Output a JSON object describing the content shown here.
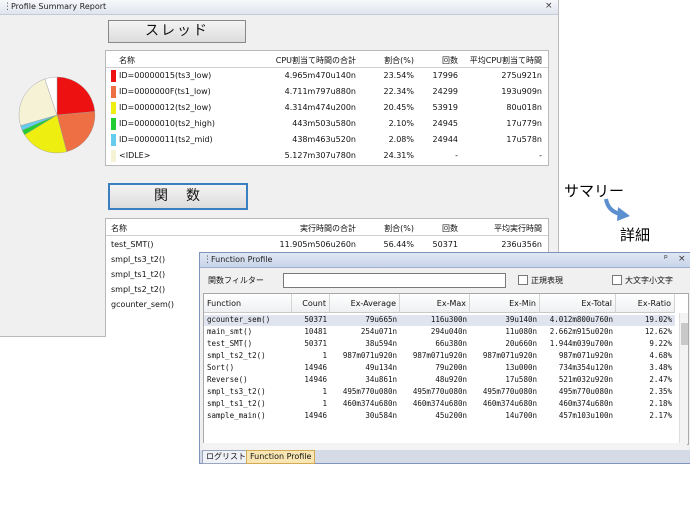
{
  "summary_window": {
    "title": "Profile Summary Report",
    "close": "×",
    "thread_button": "スレッド",
    "function_button": "関　数",
    "thread_table": {
      "headers": [
        "名称",
        "CPU割当て時間の合計",
        "割合(%)",
        "回数",
        "平均CPU割当て時間"
      ],
      "rows": [
        {
          "color": "#ee1111",
          "name": "ID=00000015(ts3_low)",
          "cpu": "4.965m470u140n",
          "pct": "23.54%",
          "count": "17996",
          "avg": "275u921n"
        },
        {
          "color": "#ee6f44",
          "name": "ID=0000000F(ts1_low)",
          "cpu": "4.711m797u880n",
          "pct": "22.34%",
          "count": "24299",
          "avg": "193u909n"
        },
        {
          "color": "#eeee11",
          "name": "ID=00000012(ts2_low)",
          "cpu": "4.314m474u200n",
          "pct": "20.45%",
          "count": "53919",
          "avg": "80u018n"
        },
        {
          "color": "#22cc33",
          "name": "ID=00000010(ts2_high)",
          "cpu": "443m503u580n",
          "pct": "2.10%",
          "count": "24945",
          "avg": "17u779n"
        },
        {
          "color": "#66ccee",
          "name": "ID=00000011(ts2_mid)",
          "cpu": "438m463u520n",
          "pct": "2.08%",
          "count": "24944",
          "avg": "17u578n"
        },
        {
          "color": "#f6f2d6",
          "name": "<IDLE>",
          "cpu": "5.127m307u780n",
          "pct": "24.31%",
          "count": "-",
          "avg": "-"
        }
      ]
    },
    "function_table": {
      "headers": [
        "名称",
        "実行時間の合計",
        "割合(%)",
        "回数",
        "平均実行時間"
      ],
      "rows": [
        {
          "name": "test_SMT()",
          "total": "11.905m506u260n",
          "pct": "56.44%",
          "count": "50371",
          "avg": "236u356n"
        },
        {
          "name": "smpl_ts3_t2()",
          "total": "",
          "pct": "",
          "count": "",
          "avg": ""
        },
        {
          "name": "smpl_ts1_t2()",
          "total": "",
          "pct": "",
          "count": "",
          "avg": ""
        },
        {
          "name": "smpl_ts2_t2()",
          "total": "",
          "pct": "",
          "count": "",
          "avg": ""
        },
        {
          "name": "gcounter_sem()",
          "total": "",
          "pct": "",
          "count": "",
          "avg": ""
        }
      ]
    },
    "pie_slices": [
      {
        "color": "#ee1111",
        "pct": 23.54
      },
      {
        "color": "#ee6f44",
        "pct": 22.34
      },
      {
        "color": "#eeee11",
        "pct": 20.45
      },
      {
        "color": "#22cc33",
        "pct": 2.1
      },
      {
        "color": "#66ccee",
        "pct": 2.08
      },
      {
        "color": "#f6f2d6",
        "pct": 24.31
      },
      {
        "color": "#ffffff",
        "pct": 5.18
      }
    ]
  },
  "annotations": {
    "summary_label": "サマリー",
    "detail_label": "詳細",
    "arrow_icon": "curved-arrow-icon"
  },
  "function_profile": {
    "title": "Function Profile",
    "pin": "ᵖ",
    "close": "×",
    "filter_label": "関数フィルター",
    "filter_value": "",
    "regex_label": "正規表現",
    "case_label": "大文字小文字",
    "columns": [
      "Function",
      "Count",
      "Ex-Average",
      "Ex-Max",
      "Ex-Min",
      "Ex-Total",
      "Ex-Ratio"
    ],
    "rows": [
      [
        "gcounter_sem()",
        "50371",
        "79u665n",
        "116u300n",
        "39u140n",
        "4.012m800u760n",
        "19.02%"
      ],
      [
        "main_smt()",
        "10481",
        "254u071n",
        "294u040n",
        "11u080n",
        "2.662m915u020n",
        "12.62%"
      ],
      [
        "test_SMT()",
        "50371",
        "38u594n",
        "66u380n",
        "20u660n",
        "1.944m039u700n",
        "9.22%"
      ],
      [
        "smpl_ts2_t2()",
        "1",
        "987m071u920n",
        "987m071u920n",
        "987m071u920n",
        "987m071u920n",
        "4.68%"
      ],
      [
        "Sort()",
        "14946",
        "49u134n",
        "79u200n",
        "13u000n",
        "734m354u120n",
        "3.48%"
      ],
      [
        "Reverse()",
        "14946",
        "34u861n",
        "48u920n",
        "17u580n",
        "521m032u920n",
        "2.47%"
      ],
      [
        "smpl_ts3_t2()",
        "1",
        "495m770u080n",
        "495m770u080n",
        "495m770u080n",
        "495m770u080n",
        "2.35%"
      ],
      [
        "smpl_ts1_t2()",
        "1",
        "460m374u680n",
        "460m374u680n",
        "460m374u680n",
        "460m374u680n",
        "2.18%"
      ],
      [
        "sample_main()",
        "14946",
        "30u584n",
        "45u200n",
        "14u700n",
        "457m103u100n",
        "2.17%"
      ]
    ],
    "tabs": [
      "ログリスト",
      "Function Profile"
    ],
    "active_tab": 1
  }
}
